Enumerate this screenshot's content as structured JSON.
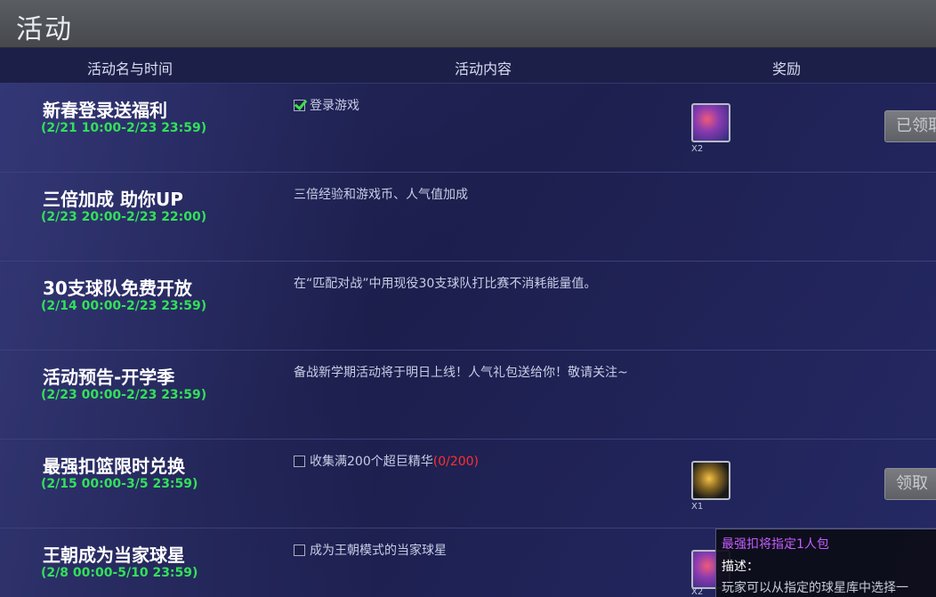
{
  "window": {
    "title": "活动"
  },
  "table": {
    "headers": {
      "name_time": "活动名与时间",
      "content": "活动内容",
      "reward": "奖励"
    },
    "rows": [
      {
        "name": "新春登录送福利",
        "time": "(2/21 10:00-2/23 23:59)",
        "content_checkbox": "checked",
        "content": "登录游戏",
        "reward_icon": "player-card-icon",
        "reward_count": "X2",
        "button": "已领取"
      },
      {
        "name": "三倍加成 助你UP",
        "time": "(2/23 20:00-2/23 22:00)",
        "content": "三倍经验和游戏币、人气值加成"
      },
      {
        "name": "30支球队免费开放",
        "time": "(2/14 00:00-2/23 23:59)",
        "content": "在“匹配对战”中用现役30支球队打比赛不消耗能量值。"
      },
      {
        "name": "活动预告-开学季",
        "time": "(2/23 00:00-2/23 23:59)",
        "content": "备战新学期活动将于明日上线！人气礼包送给你！敬请关注~"
      },
      {
        "name": "最强扣篮限时兑换",
        "time": "(2/15 00:00-3/5 23:59)",
        "content_checkbox": "unchecked",
        "content": "收集满200个超巨精华",
        "progress": "(0/200)",
        "reward_icon": "essence-pack-icon",
        "reward_count": "X1",
        "button": "领取"
      },
      {
        "name": "王朝成为当家球星",
        "time": "(2/8 00:00-5/10 23:59)",
        "content_checkbox": "unchecked",
        "content": "成为王朝模式的当家球星",
        "reward_icon": "player-card-icon",
        "reward_count": "X2"
      }
    ]
  },
  "tooltip": {
    "title": "最强扣将指定1人包",
    "label": "描述：",
    "desc": "玩家可以从指定的球星库中选择一"
  },
  "colors": {
    "time_green": "#32e05a",
    "progress_red": "#ff3030",
    "tooltip_title_purple": "#c55cff"
  }
}
